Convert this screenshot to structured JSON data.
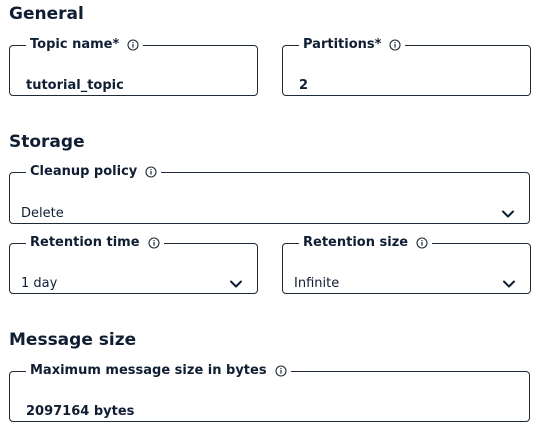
{
  "general": {
    "heading": "General",
    "topic_name": {
      "label": "Topic name*",
      "value": "tutorial_topic",
      "info_icon": "info-circle-icon"
    },
    "partitions": {
      "label": "Partitions*",
      "value": "2",
      "info_icon": "info-circle-icon"
    }
  },
  "storage": {
    "heading": "Storage",
    "cleanup_policy": {
      "label": "Cleanup policy",
      "selected": "Delete",
      "info_icon": "info-circle-icon",
      "dropdown_icon": "chevron-down-icon"
    },
    "retention_time": {
      "label": "Retention time",
      "selected": "1 day",
      "info_icon": "info-circle-icon",
      "dropdown_icon": "chevron-down-icon"
    },
    "retention_size": {
      "label": "Retention size",
      "selected": "Infinite",
      "info_icon": "info-circle-icon",
      "dropdown_icon": "chevron-down-icon"
    }
  },
  "message_size": {
    "heading": "Message size",
    "max_message_size": {
      "label": "Maximum message size in bytes",
      "value": "2097164 bytes",
      "info_icon": "info-circle-icon"
    }
  },
  "colors": {
    "text": "#0f1e33",
    "border": "#1e2a38",
    "background": "#ffffff"
  }
}
